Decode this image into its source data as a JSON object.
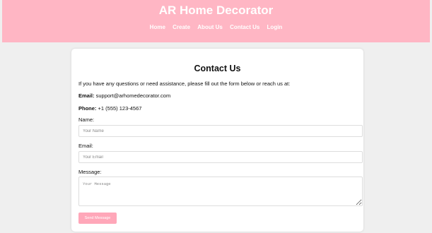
{
  "header": {
    "brand": "AR Home Decorator",
    "nav": [
      "Home",
      "Create",
      "About Us",
      "Contact Us",
      "Login"
    ]
  },
  "contact": {
    "title": "Contact Us",
    "intro": "If you have any questions or need assistance, please fill out the form below or reach us at:",
    "email_label": "Email:",
    "email_value": "support@arhomedecorator.com",
    "phone_label": "Phone:",
    "phone_value": "+1 (555) 123-4567"
  },
  "form": {
    "name_label": "Name:",
    "name_placeholder": "Your Name",
    "email_label": "Email:",
    "email_placeholder": "Your Email",
    "message_label": "Message:",
    "message_placeholder": "Your Message",
    "send_label": "Send Message"
  },
  "colors": {
    "header_bg": "#ffb6c4",
    "button_bg": "#ffa7b9",
    "page_bg": "#efefef"
  }
}
